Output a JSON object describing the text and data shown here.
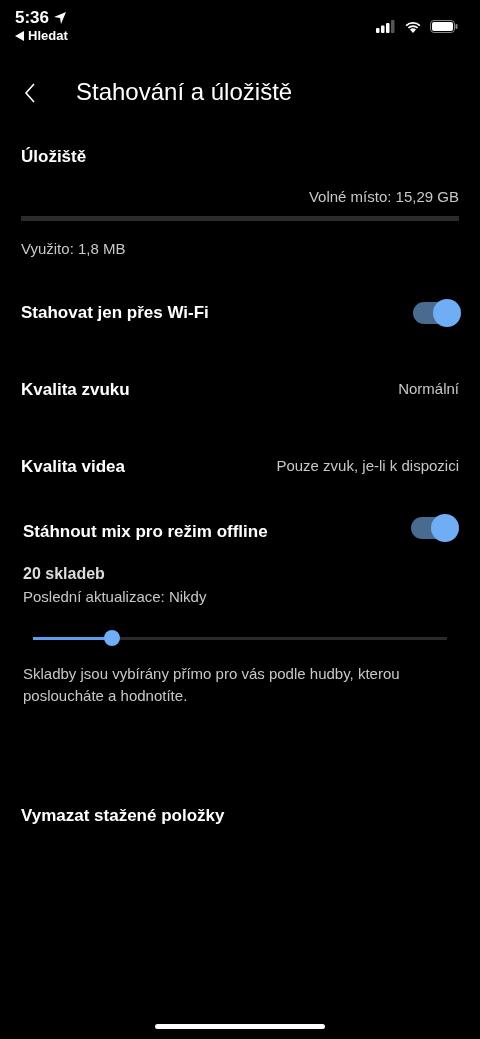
{
  "status_bar": {
    "time": "5:36",
    "back_app": "Hledat"
  },
  "header": {
    "title": "Stahování a úložiště"
  },
  "storage": {
    "title": "Úložiště",
    "free": "Volné místo: 15,29 GB",
    "used": "Využito: 1,8 MB"
  },
  "settings": [
    {
      "kind": "toggle",
      "label": "Stahovat jen přes Wi-Fi",
      "on": true
    },
    {
      "kind": "value",
      "label": "Kvalita zvuku",
      "value": "Normální"
    },
    {
      "kind": "value",
      "label": "Kvalita videa",
      "value": "Pouze zvuk, je-li k dispozici"
    }
  ],
  "offline_mix": {
    "label": "Stáhnout mix pro režim offline",
    "on": true,
    "count": "20 skladeb",
    "updated": "Poslední aktualizace: Nikdy",
    "level": 0.19,
    "description": "Skladby jsou vybírány přímo pro vás podle hudby, kterou posloucháte a hodnotíte."
  },
  "clear": {
    "label": "Vymazat stažené položky"
  }
}
